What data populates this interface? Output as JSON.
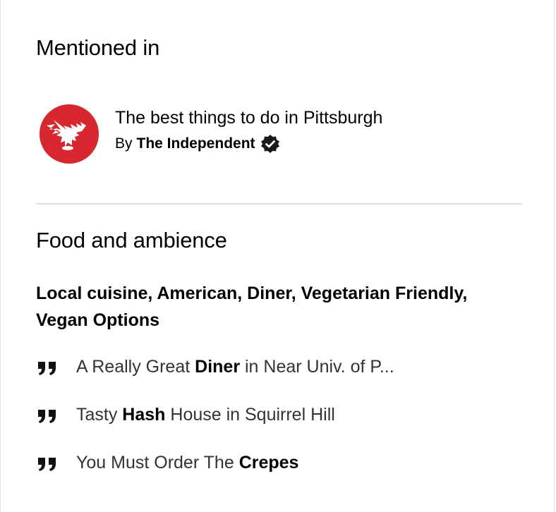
{
  "mentioned": {
    "title": "Mentioned in",
    "item": {
      "title": "The best things to do in Pittsburgh",
      "by_prefix": "By",
      "author": "The Independent",
      "logo_color": "#d7282f",
      "logo_icon": "eagle-icon",
      "verified_icon": "verified-badge-icon"
    }
  },
  "food": {
    "title": "Food and ambience",
    "cuisines": "Local cuisine, American, Diner, Vegetarian Friendly, Vegan Options",
    "quotes": [
      {
        "before": "A Really Great ",
        "keyword": "Diner",
        "after": " in Near Univ. of P..."
      },
      {
        "before": "Tasty ",
        "keyword": "Hash",
        "after": " House in Squirrel Hill"
      },
      {
        "before": "You Must Order The ",
        "keyword": "Crepes",
        "after": ""
      }
    ],
    "quote_icon": "quote-icon"
  },
  "colors": {
    "divider": "#e0e0e0",
    "text_muted": "#333333",
    "brand_red": "#d7282f"
  }
}
